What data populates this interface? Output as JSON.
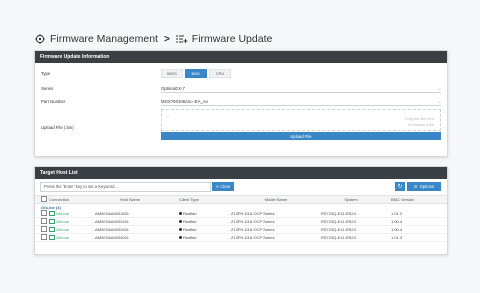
{
  "breadcrumb": {
    "root_icon": "target-icon",
    "root_label": "Firmware Management",
    "separator": ">",
    "child_icon": "list-plus-icon",
    "child_label": "Firmware Update"
  },
  "firmware_panel": {
    "title": "Firmware Update Information",
    "type_label": "Type",
    "type_options": [
      "BIOS",
      "BMC",
      "CPU"
    ],
    "type_selected": "BMC",
    "series_label": "Series",
    "series_value": "OptimaGX-7",
    "part_label": "Part Number",
    "part_value": "MGX750106AS=-EA_Ax",
    "file_label": "Upload File (.bin)",
    "dropzone_hint": "Drop the file here\nor Browse a file",
    "dropzone_tag": "File",
    "upload_label": "Upload File"
  },
  "target_panel": {
    "title": "Target Host List",
    "search_placeholder": "Press the 'Enter' key to set a Keyword...",
    "clear_label": "Clear",
    "options_label": "Options",
    "columns": [
      "",
      "Connection",
      "Host Name",
      "Client Type",
      "Model Name",
      "System",
      "BMC Version"
    ],
    "group_label": "OnLine (4)",
    "rows": [
      {
        "connection": "OnLine",
        "host": "AM00XAA0001601",
        "client": "Redfish",
        "model": "Z13PH-D16-OCP Series",
        "system": "RS723Q-E11-RS24",
        "bmc": "1.01.2"
      },
      {
        "connection": "OnLine",
        "host": "AM00XAA0002401",
        "client": "Redfish",
        "model": "Z13PH-D16-OCP Series",
        "system": "RS723Q-E11-RS24",
        "bmc": "1.00.4"
      },
      {
        "connection": "OnLine",
        "host": "AM00XAA0002601",
        "client": "Redfish",
        "model": "Z13PH-D16-OCP Series",
        "system": "RS723Q-E11-RS24",
        "bmc": "1.00.4"
      },
      {
        "connection": "OnLine",
        "host": "AM00XAA0004001",
        "client": "Redfish",
        "model": "Z13PH-D16-OCP Series",
        "system": "RS723Q-E11-RS24",
        "bmc": "1.01.3"
      }
    ]
  },
  "colors": {
    "accent": "#3a87c8",
    "header_dark": "#3a3f44",
    "online_green": "#2ea36a"
  }
}
